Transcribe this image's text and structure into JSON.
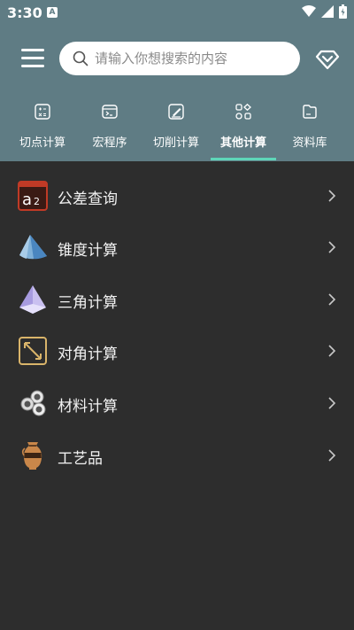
{
  "status_bar": {
    "time": "3:30",
    "notification_icon": "a-notification-icon"
  },
  "header": {
    "menu_icon": "hamburger-menu-icon",
    "search": {
      "placeholder": "请输入你想搜索的内容",
      "value": ""
    },
    "vip_icon": "diamond-vip-icon"
  },
  "tabs": [
    {
      "label": "切点计算",
      "icon": "calculator-icon",
      "active": false
    },
    {
      "label": "宏程序",
      "icon": "terminal-icon",
      "active": false
    },
    {
      "label": "切削计算",
      "icon": "edit-pen-icon",
      "active": false
    },
    {
      "label": "其他计算",
      "icon": "grid-shapes-icon",
      "active": true
    },
    {
      "label": "资料库",
      "icon": "folder-icon",
      "active": false
    }
  ],
  "list": [
    {
      "label": "公差查询",
      "icon": "tolerance-a2-icon"
    },
    {
      "label": "锥度计算",
      "icon": "cone-icon"
    },
    {
      "label": "三角计算",
      "icon": "pyramid-icon"
    },
    {
      "label": "对角计算",
      "icon": "diagonal-icon"
    },
    {
      "label": "材料计算",
      "icon": "metal-pipes-icon"
    },
    {
      "label": "工艺品",
      "icon": "vase-icon"
    }
  ],
  "colors": {
    "header_bg": "#5f7c84",
    "body_bg": "#2d2d2d",
    "tab_indicator": "#5ed6b8"
  }
}
